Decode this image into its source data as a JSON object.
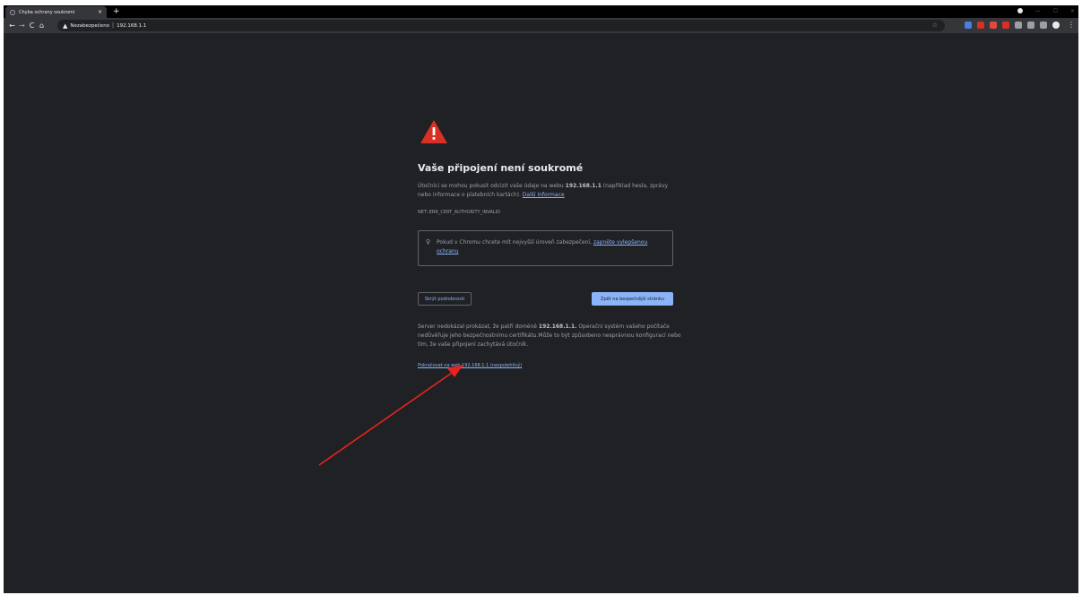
{
  "browser": {
    "tab_title": "Chyba ochrany soukromí",
    "close_glyph": "×",
    "newtab_glyph": "+",
    "win_min": "—",
    "win_max": "☐",
    "win_close": "×",
    "back_glyph": "←",
    "forward_glyph": "→",
    "reload_glyph": "C",
    "home_glyph": "⌂",
    "security_glyph": "▲",
    "security_label": "Nezabezpečeno",
    "url_separator": "|",
    "url": "192.168.1.1",
    "star_glyph": "☆",
    "menu_glyph": "⋮",
    "extensions": [
      {
        "icon": "translate-extension-icon",
        "color": "#4a7de0"
      },
      {
        "icon": "adblock-extension-icon",
        "color": "#d93025"
      },
      {
        "icon": "red-round-extension-icon",
        "color": "#e04a3a"
      },
      {
        "icon": "red-square-extension-icon",
        "color": "#d93025"
      },
      {
        "icon": "snowflake-extension-icon",
        "color": "#9aa0a6"
      },
      {
        "icon": "grid-extension-icon",
        "color": "#9aa0a6"
      },
      {
        "icon": "puzzle-extension-icon",
        "color": "#9aa0a6"
      },
      {
        "icon": "profile-avatar-icon",
        "color": "#e8eaed"
      }
    ]
  },
  "interstitial": {
    "headline": "Vaše připojení není soukromé",
    "para1_pre": "Útočníci se mohou pokusit odcizit vaše údaje na webu ",
    "para1_host": "192.168.1.1",
    "para1_post": " (například hesla, zprávy nebo informace o platebních kartách). ",
    "learn_more": "Další informace",
    "error_code": "NET::ERR_CERT_AUTHORITY_INVALID",
    "bulb_glyph": "♀",
    "safebrowsing_pre": "Pokud v Chromu chcete mít nejvyšší úroveň zabezpečení, ",
    "safebrowsing_link": "zapněte vylepšenou ochranu",
    "details_button": "Skrýt podrobnosti",
    "back_button": "Zpět na bezpečnější stránku",
    "para3_pre": "Server nedokázal prokázat, že patří doméně ",
    "para3_host": "192.168.1.1.",
    "para3_post": " Operační systém vašeho počítače nedůvěřuje jeho bezpečnostnímu certifikátu.Může to být způsobeno nesprávnou konfigurací nebo tím, že vaše připojení zachytává útočník.",
    "proceed_link": "Pokračovat na web 192.168.1.1 (nespolehlivý)",
    "accent_color": "#8ab4f8",
    "warning_color": "#d93025"
  }
}
